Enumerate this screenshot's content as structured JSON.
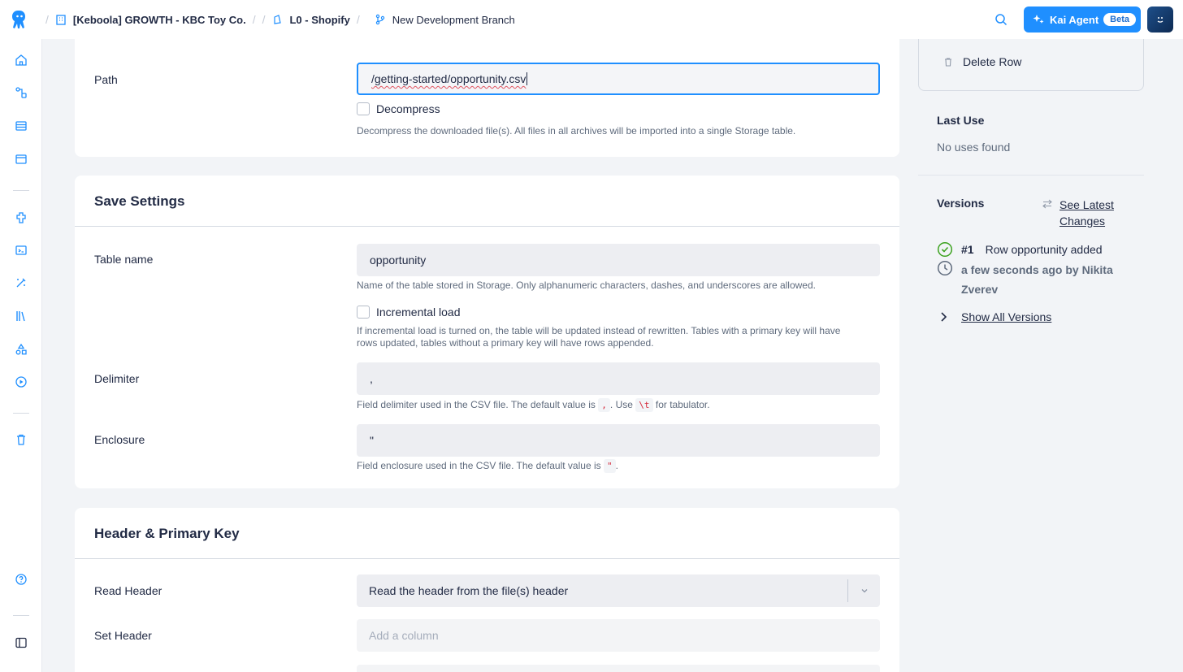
{
  "breadcrumb": {
    "project": "[Keboola] GROWTH - KBC Toy Co.",
    "component": "L0 - Shopify",
    "branch": "New Development Branch",
    "separator": "/"
  },
  "topbar": {
    "kai_label": "Kai Agent",
    "kai_badge": "Beta"
  },
  "source": {
    "path_label": "Path",
    "path_value": "/getting-started/opportunity.csv",
    "decompress_label": "Decompress",
    "decompress_help": "Decompress the downloaded file(s). All files in all archives will be imported into a single Storage table."
  },
  "save_settings": {
    "title": "Save Settings",
    "table_name_label": "Table name",
    "table_name_value": "opportunity",
    "table_name_help": "Name of the table stored in Storage. Only alphanumeric characters, dashes, and underscores are allowed.",
    "incremental_label": "Incremental load",
    "incremental_help_1": "If incremental load is turned on, the table will be updated instead of rewritten. Tables with a primary key will have",
    "incremental_help_2": "rows updated, tables without a primary key will have rows appended.",
    "delimiter_label": "Delimiter",
    "delimiter_value": ",",
    "delimiter_help_a": "Field delimiter used in the CSV file. The default value is",
    "delimiter_help_code1": ",",
    "delimiter_help_b": ". Use",
    "delimiter_help_code2": "\\t",
    "delimiter_help_c": "for tabulator.",
    "enclosure_label": "Enclosure",
    "enclosure_value": "\"",
    "enclosure_help_a": "Field enclosure used in the CSV file. The default value is",
    "enclosure_help_code": "\"",
    "enclosure_help_b": "."
  },
  "header_pk": {
    "title": "Header & Primary Key",
    "read_header_label": "Read Header",
    "read_header_value": "Read the header from the file(s) header",
    "set_header_label": "Set Header",
    "set_header_placeholder": "Add a column"
  },
  "right_panel": {
    "delete_row_label": "Delete Row",
    "last_use_title": "Last Use",
    "last_use_value": "No uses found",
    "versions_title": "Versions",
    "see_latest_line1": "See Latest",
    "see_latest_line2": "Changes",
    "version_number": "#1",
    "version_desc": "Row opportunity added",
    "version_time_line1": "a few seconds ago by Nikita",
    "version_time_line2": "Zverev",
    "show_all_versions": "Show All Versions"
  },
  "colors": {
    "accent": "#1f8fff",
    "success": "#3ca21f",
    "code_red": "#d6293b"
  }
}
